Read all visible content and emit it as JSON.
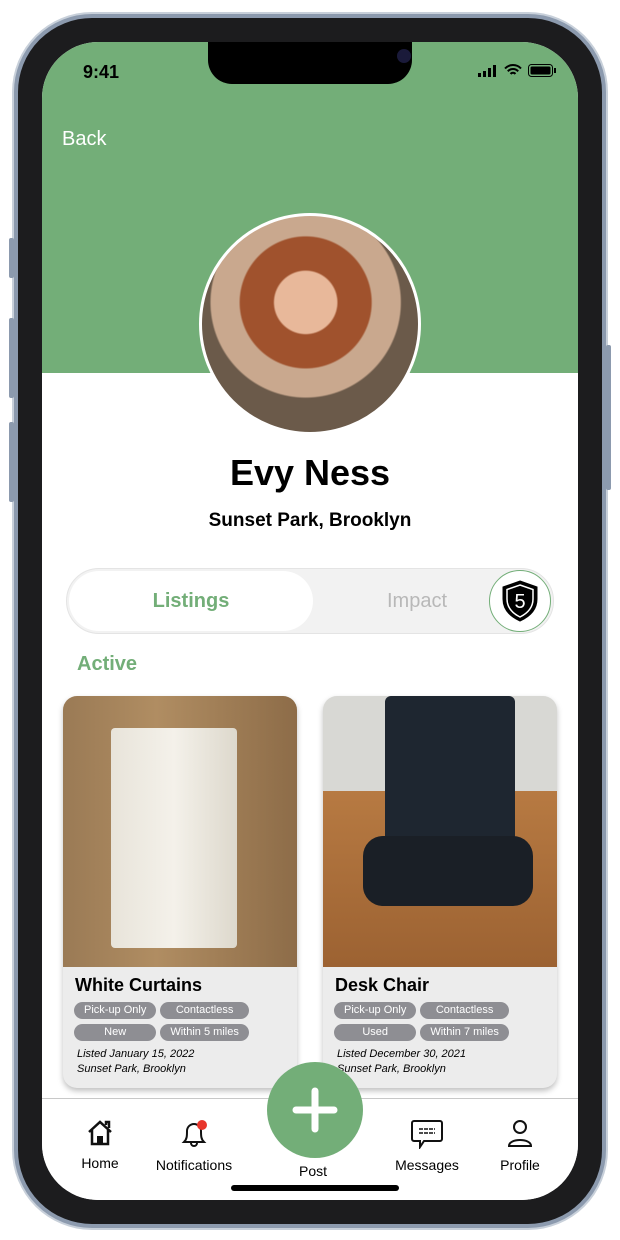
{
  "status_bar": {
    "time": "9:41"
  },
  "header": {
    "back_label": "Back"
  },
  "profile": {
    "name": "Evy Ness",
    "location": "Sunset Park, Brooklyn",
    "badge_level": "5"
  },
  "tabs": [
    {
      "label": "Listings",
      "active": true
    },
    {
      "label": "Impact",
      "active": false
    }
  ],
  "section": {
    "title": "Active"
  },
  "listings": [
    {
      "title": "White Curtains",
      "tags": [
        "Pick-up Only",
        "Contactless",
        "New",
        "Within 5 miles"
      ],
      "listed": "Listed January 15, 2022",
      "location": "Sunset Park, Brooklyn"
    },
    {
      "title": "Desk Chair",
      "tags": [
        "Pick-up Only",
        "Contactless",
        "Used",
        "Within 7 miles"
      ],
      "listed": "Listed December 30, 2021",
      "location": "Sunset Park, Brooklyn"
    }
  ],
  "nav": {
    "home": "Home",
    "notifications": "Notifications",
    "post": "Post",
    "messages": "Messages",
    "profile": "Profile"
  },
  "colors": {
    "accent": "#73ae78",
    "notification_dot": "#e8352b"
  }
}
